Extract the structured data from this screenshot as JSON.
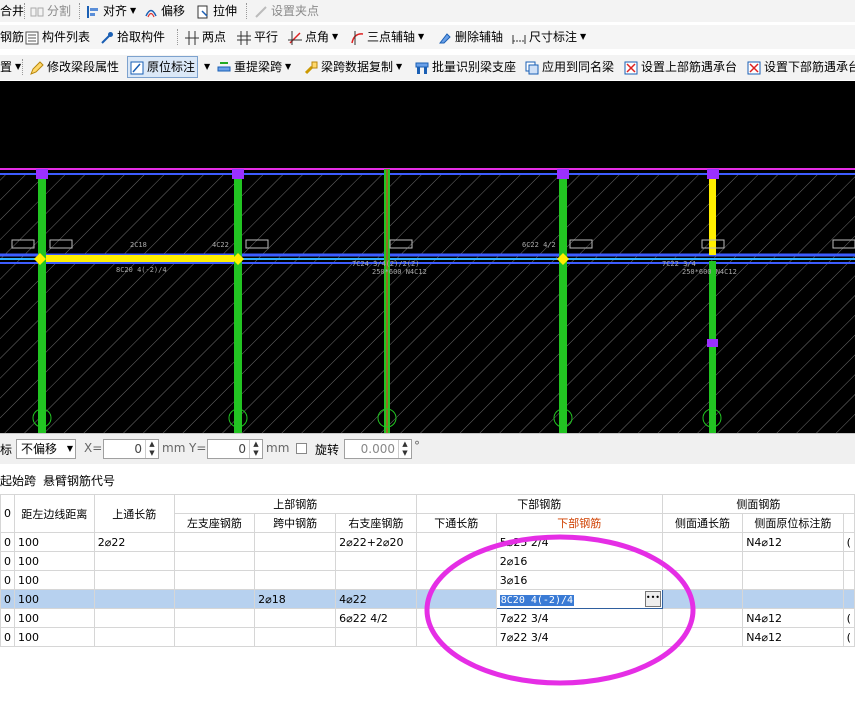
{
  "toolbar1": {
    "merge_label": "合井",
    "split_label": "分割",
    "align_label": "对齐",
    "offset_label": "偏移",
    "stretch_label": "拉伸",
    "grip_label": "设置夹点"
  },
  "toolbar2": {
    "rebar_label": "钢筋",
    "component_list_label": "构件列表",
    "pick_component_label": "拾取构件",
    "two_point_label": "两点",
    "parallel_label": "平行",
    "point_angle_label": "点角",
    "three_point_label": "三点辅轴",
    "delete_axis_label": "删除辅轴",
    "dimension_label": "尺寸标注"
  },
  "toolbar3": {
    "cut_label": "置",
    "modify_segment_label": "修改梁段属性",
    "original_mark_label": "原位标注",
    "respan_label": "重提梁跨",
    "span_copy_label": "梁跨数据复制",
    "batch_support_label": "批量识别梁支座",
    "apply_same_label": "应用到同名梁",
    "set_upper_label": "设置上部筋遇承台",
    "set_lower_label": "设置下部筋遇承台"
  },
  "cad_labels": {
    "l1": "2C18",
    "l2": "4C22",
    "l3": "8C20 4(-2)/4",
    "l4": "7C24 3/4(2)/2(2)",
    "l5": "250*600 N4C12",
    "l6": "6C22 4/2",
    "l7": "7C22 3/4",
    "l8": "250*600 N4C12"
  },
  "coords": {
    "offset_label": "标",
    "offset_value": "不偏移",
    "x_label": "X=",
    "x_value": "0",
    "mm1": "mm",
    "y_label": "Y=",
    "y_value": "0",
    "mm2": "mm",
    "rotate_label": "旋转",
    "rotate_value": "0.000",
    "degree": "°"
  },
  "tabs": {
    "start_span": "起始跨",
    "cantilever_code": "悬臂钢筋代号"
  },
  "table": {
    "group_upper": "上部钢筋",
    "group_lower": "下部钢筋",
    "group_side": "侧面钢筋",
    "col_id": "0",
    "col_dist": "距左边线距离",
    "col_top_through": "上通长筋",
    "col_left_support": "左支座钢筋",
    "col_mid_span": "跨中钢筋",
    "col_right_support": "右支座钢筋",
    "col_bottom_through": "下通长筋",
    "col_bottom": "下部钢筋",
    "col_side_through": "侧面通长筋",
    "col_side_mark": "侧面原位标注筋",
    "rows": [
      {
        "id": "0",
        "dist": "100",
        "top": "2⌀22",
        "left": "",
        "mid": "",
        "right": "2⌀22+2⌀20",
        "bthrough": "",
        "bottom": "5⌀25 2/4",
        "side": "",
        "sidemark": "N4⌀12",
        "extra": "("
      },
      {
        "id": "0",
        "dist": "100",
        "top": "",
        "left": "",
        "mid": "",
        "right": "",
        "bthrough": "",
        "bottom": "2⌀16",
        "side": "",
        "sidemark": "",
        "extra": ""
      },
      {
        "id": "0",
        "dist": "100",
        "top": "",
        "left": "",
        "mid": "",
        "right": "",
        "bthrough": "",
        "bottom": "3⌀16",
        "side": "",
        "sidemark": "",
        "extra": ""
      },
      {
        "id": "0",
        "dist": "100",
        "top": "",
        "left": "",
        "mid": "2⌀18",
        "right": "4⌀22",
        "bthrough": "",
        "bottom": "8C20 4(-2)/4",
        "side": "",
        "sidemark": "",
        "extra": ""
      },
      {
        "id": "0",
        "dist": "100",
        "top": "",
        "left": "",
        "mid": "",
        "right": "6⌀22 4/2",
        "bthrough": "",
        "bottom": "7⌀22 3/4",
        "side": "",
        "sidemark": "N4⌀12",
        "extra": "("
      },
      {
        "id": "0",
        "dist": "100",
        "top": "",
        "left": "",
        "mid": "",
        "right": "",
        "bthrough": "",
        "bottom": "7⌀22 3/4",
        "side": "",
        "sidemark": "N4⌀12",
        "extra": "("
      }
    ]
  },
  "colors": {
    "cad_bg": "#000000",
    "column_green": "#22c422",
    "beam_blue": "#2f62ff",
    "selected_yellow": "#ffee00",
    "annotation_magenta": "#e52ee5"
  }
}
